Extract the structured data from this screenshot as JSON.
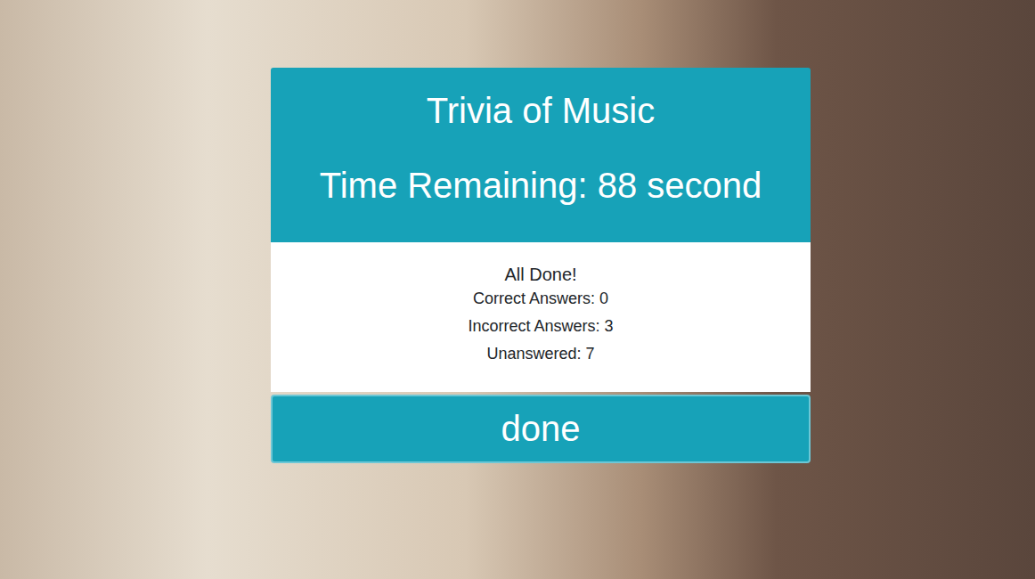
{
  "app": {
    "title": "Trivia of Music",
    "timer": "Time Remaining: 88 second"
  },
  "results": {
    "heading": "All Done!",
    "stats": [
      "Correct Answers: 0",
      "Incorrect Answers: 3",
      "Unanswered: 7"
    ]
  },
  "buttons": [
    "done"
  ]
}
